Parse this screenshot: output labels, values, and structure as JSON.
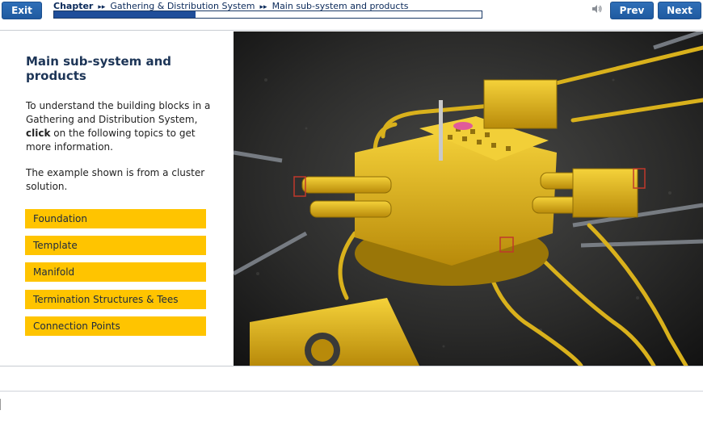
{
  "nav": {
    "exit_label": "Exit",
    "prev_label": "Prev",
    "next_label": "Next"
  },
  "breadcrumb": {
    "chapter": "Chapter",
    "section": "Gathering & Distribution System",
    "page": "Main sub-system and products"
  },
  "progress": {
    "fraction": 0.33
  },
  "icons": {
    "sound": "speaker-icon",
    "separator": "double-chevron-icon"
  },
  "colors": {
    "accent": "#1f5aa0",
    "topic_bg": "#ffc400",
    "title": "#1d3557"
  },
  "main": {
    "title": "Main sub-system and products",
    "intro_prefix": "To understand the building blocks in a Gathering and Distribution System,",
    "intro_bold": "click",
    "intro_suffix": "on the following topics to get more information.",
    "note": "The example shown is from a cluster solution.",
    "topics": [
      {
        "label": "Foundation"
      },
      {
        "label": "Template"
      },
      {
        "label": "Manifold"
      },
      {
        "label": "Termination Structures & Tees"
      },
      {
        "label": "Connection Points"
      }
    ]
  }
}
